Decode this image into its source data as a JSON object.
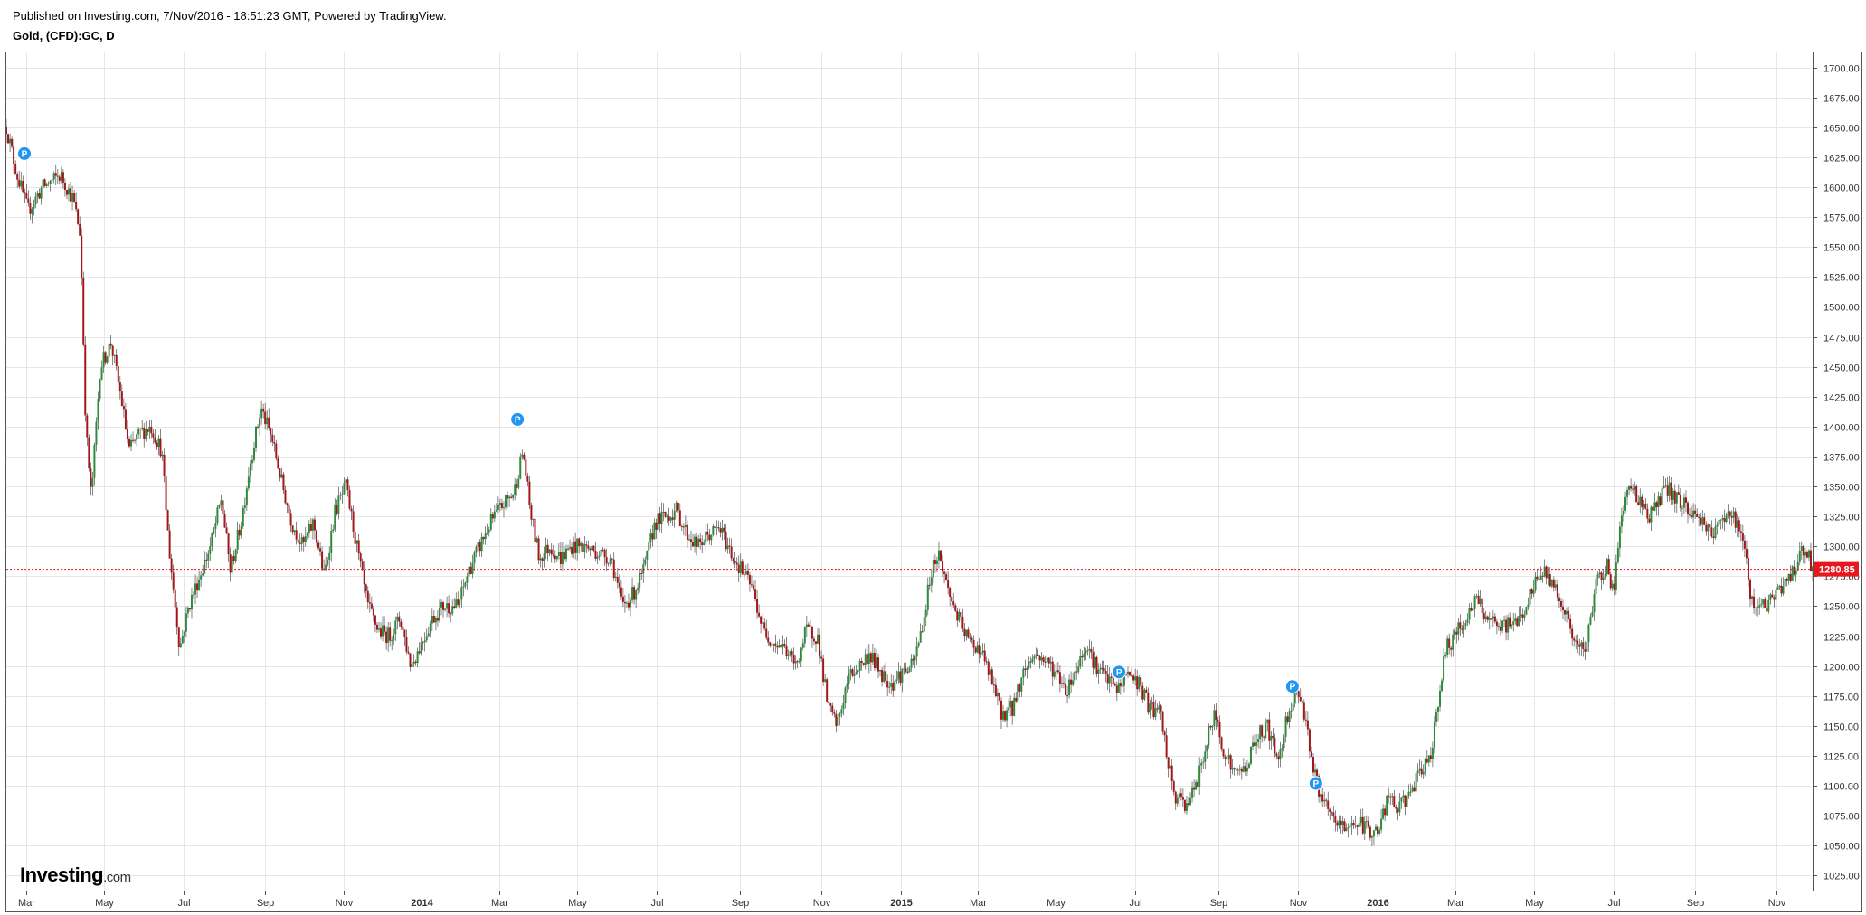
{
  "header": {
    "published": "Published on Investing.com, 7/Nov/2016 - 18:51:23 GMT, Powered by TradingView.",
    "symbol": "Gold, (CFD):GC, D"
  },
  "logo": {
    "brand": "Investing",
    "suffix": ".com"
  },
  "colors": {
    "up": "#2e8b3c",
    "down": "#a3171b",
    "wick": "#333333",
    "price_line": "#e8161d",
    "grid": "#e6e6e6"
  },
  "chart_data": {
    "type": "candlestick",
    "title": "Gold, (CFD):GC, D",
    "ylim": [
      1012.5,
      1712.5
    ],
    "yticks": [
      "1700.00",
      "1675.00",
      "1650.00",
      "1625.00",
      "1600.00",
      "1575.00",
      "1550.00",
      "1525.00",
      "1500.00",
      "1475.00",
      "1450.00",
      "1425.00",
      "1400.00",
      "1375.00",
      "1350.00",
      "1325.00",
      "1300.00",
      "1275.00",
      "1250.00",
      "1225.00",
      "1200.00",
      "1175.00",
      "1150.00",
      "1125.00",
      "1100.00",
      "1075.00",
      "1050.00",
      "1025.00"
    ],
    "xticks": [
      {
        "label": "Mar",
        "t": 0.011,
        "bold": false
      },
      {
        "label": "May",
        "t": 0.054,
        "bold": false
      },
      {
        "label": "Jul",
        "t": 0.098,
        "bold": false
      },
      {
        "label": "Sep",
        "t": 0.143,
        "bold": false
      },
      {
        "label": "Nov",
        "t": 0.187,
        "bold": false
      },
      {
        "label": "2014",
        "t": 0.23,
        "bold": true
      },
      {
        "label": "Mar",
        "t": 0.273,
        "bold": false
      },
      {
        "label": "May",
        "t": 0.316,
        "bold": false
      },
      {
        "label": "Jul",
        "t": 0.36,
        "bold": false
      },
      {
        "label": "Sep",
        "t": 0.406,
        "bold": false
      },
      {
        "label": "Nov",
        "t": 0.451,
        "bold": false
      },
      {
        "label": "2015",
        "t": 0.495,
        "bold": true
      },
      {
        "label": "Mar",
        "t": 0.538,
        "bold": false
      },
      {
        "label": "May",
        "t": 0.581,
        "bold": false
      },
      {
        "label": "Jul",
        "t": 0.625,
        "bold": false
      },
      {
        "label": "Sep",
        "t": 0.671,
        "bold": false
      },
      {
        "label": "Nov",
        "t": 0.715,
        "bold": false
      },
      {
        "label": "2016",
        "t": 0.759,
        "bold": true
      },
      {
        "label": "Mar",
        "t": 0.802,
        "bold": false
      },
      {
        "label": "May",
        "t": 0.846,
        "bold": false
      },
      {
        "label": "Jul",
        "t": 0.89,
        "bold": false
      },
      {
        "label": "Sep",
        "t": 0.935,
        "bold": false
      },
      {
        "label": "Nov",
        "t": 0.98,
        "bold": false
      }
    ],
    "current_price": 1280.85,
    "current_price_label": "1280.85",
    "trend": [
      [
        0.0,
        1650
      ],
      [
        0.006,
        1610
      ],
      [
        0.012,
        1580
      ],
      [
        0.02,
        1600
      ],
      [
        0.03,
        1610
      ],
      [
        0.037,
        1590
      ],
      [
        0.041,
        1560
      ],
      [
        0.044,
        1400
      ],
      [
        0.047,
        1340
      ],
      [
        0.052,
        1450
      ],
      [
        0.058,
        1470
      ],
      [
        0.064,
        1420
      ],
      [
        0.068,
        1380
      ],
      [
        0.074,
        1395
      ],
      [
        0.08,
        1400
      ],
      [
        0.086,
        1380
      ],
      [
        0.09,
        1300
      ],
      [
        0.096,
        1215
      ],
      [
        0.101,
        1250
      ],
      [
        0.107,
        1275
      ],
      [
        0.113,
        1300
      ],
      [
        0.119,
        1340
      ],
      [
        0.124,
        1280
      ],
      [
        0.13,
        1320
      ],
      [
        0.135,
        1370
      ],
      [
        0.141,
        1415
      ],
      [
        0.147,
        1390
      ],
      [
        0.153,
        1350
      ],
      [
        0.158,
        1320
      ],
      [
        0.164,
        1300
      ],
      [
        0.17,
        1320
      ],
      [
        0.176,
        1275
      ],
      [
        0.182,
        1330
      ],
      [
        0.188,
        1350
      ],
      [
        0.194,
        1300
      ],
      [
        0.2,
        1250
      ],
      [
        0.206,
        1230
      ],
      [
        0.212,
        1225
      ],
      [
        0.218,
        1240
      ],
      [
        0.224,
        1200
      ],
      [
        0.23,
        1220
      ],
      [
        0.236,
        1240
      ],
      [
        0.242,
        1250
      ],
      [
        0.25,
        1250
      ],
      [
        0.256,
        1280
      ],
      [
        0.262,
        1300
      ],
      [
        0.268,
        1320
      ],
      [
        0.275,
        1335
      ],
      [
        0.281,
        1345
      ],
      [
        0.286,
        1380
      ],
      [
        0.29,
        1330
      ],
      [
        0.295,
        1290
      ],
      [
        0.301,
        1300
      ],
      [
        0.307,
        1290
      ],
      [
        0.313,
        1300
      ],
      [
        0.32,
        1300
      ],
      [
        0.328,
        1295
      ],
      [
        0.335,
        1290
      ],
      [
        0.341,
        1250
      ],
      [
        0.347,
        1260
      ],
      [
        0.353,
        1280
      ],
      [
        0.359,
        1320
      ],
      [
        0.365,
        1325
      ],
      [
        0.371,
        1330
      ],
      [
        0.377,
        1310
      ],
      [
        0.383,
        1300
      ],
      [
        0.389,
        1310
      ],
      [
        0.395,
        1315
      ],
      [
        0.401,
        1295
      ],
      [
        0.407,
        1280
      ],
      [
        0.413,
        1265
      ],
      [
        0.419,
        1230
      ],
      [
        0.425,
        1220
      ],
      [
        0.431,
        1215
      ],
      [
        0.437,
        1200
      ],
      [
        0.443,
        1230
      ],
      [
        0.449,
        1225
      ],
      [
        0.455,
        1165
      ],
      [
        0.46,
        1150
      ],
      [
        0.466,
        1190
      ],
      [
        0.472,
        1200
      ],
      [
        0.478,
        1210
      ],
      [
        0.484,
        1195
      ],
      [
        0.49,
        1185
      ],
      [
        0.496,
        1195
      ],
      [
        0.502,
        1200
      ],
      [
        0.508,
        1240
      ],
      [
        0.512,
        1280
      ],
      [
        0.516,
        1295
      ],
      [
        0.522,
        1260
      ],
      [
        0.527,
        1240
      ],
      [
        0.533,
        1220
      ],
      [
        0.539,
        1215
      ],
      [
        0.545,
        1190
      ],
      [
        0.551,
        1160
      ],
      [
        0.557,
        1165
      ],
      [
        0.563,
        1195
      ],
      [
        0.569,
        1210
      ],
      [
        0.575,
        1205
      ],
      [
        0.581,
        1195
      ],
      [
        0.587,
        1180
      ],
      [
        0.593,
        1200
      ],
      [
        0.598,
        1220
      ],
      [
        0.603,
        1200
      ],
      [
        0.609,
        1190
      ],
      [
        0.615,
        1180
      ],
      [
        0.621,
        1195
      ],
      [
        0.627,
        1185
      ],
      [
        0.633,
        1165
      ],
      [
        0.639,
        1160
      ],
      [
        0.643,
        1120
      ],
      [
        0.647,
        1090
      ],
      [
        0.653,
        1085
      ],
      [
        0.659,
        1100
      ],
      [
        0.665,
        1140
      ],
      [
        0.669,
        1160
      ],
      [
        0.674,
        1130
      ],
      [
        0.68,
        1110
      ],
      [
        0.686,
        1115
      ],
      [
        0.692,
        1140
      ],
      [
        0.698,
        1150
      ],
      [
        0.704,
        1120
      ],
      [
        0.71,
        1165
      ],
      [
        0.716,
        1180
      ],
      [
        0.72,
        1150
      ],
      [
        0.724,
        1110
      ],
      [
        0.729,
        1085
      ],
      [
        0.735,
        1070
      ],
      [
        0.741,
        1065
      ],
      [
        0.747,
        1070
      ],
      [
        0.753,
        1065
      ],
      [
        0.759,
        1060
      ],
      [
        0.765,
        1090
      ],
      [
        0.771,
        1080
      ],
      [
        0.777,
        1095
      ],
      [
        0.783,
        1110
      ],
      [
        0.789,
        1130
      ],
      [
        0.793,
        1175
      ],
      [
        0.797,
        1215
      ],
      [
        0.802,
        1225
      ],
      [
        0.808,
        1240
      ],
      [
        0.814,
        1255
      ],
      [
        0.82,
        1240
      ],
      [
        0.826,
        1230
      ],
      [
        0.832,
        1235
      ],
      [
        0.838,
        1240
      ],
      [
        0.844,
        1260
      ],
      [
        0.85,
        1280
      ],
      [
        0.856,
        1270
      ],
      [
        0.862,
        1250
      ],
      [
        0.868,
        1220
      ],
      [
        0.874,
        1210
      ],
      [
        0.88,
        1270
      ],
      [
        0.886,
        1285
      ],
      [
        0.89,
        1260
      ],
      [
        0.894,
        1330
      ],
      [
        0.899,
        1350
      ],
      [
        0.904,
        1340
      ],
      [
        0.909,
        1325
      ],
      [
        0.914,
        1335
      ],
      [
        0.919,
        1350
      ],
      [
        0.924,
        1340
      ],
      [
        0.929,
        1335
      ],
      [
        0.935,
        1325
      ],
      [
        0.94,
        1320
      ],
      [
        0.946,
        1310
      ],
      [
        0.952,
        1330
      ],
      [
        0.958,
        1320
      ],
      [
        0.962,
        1300
      ],
      [
        0.966,
        1255
      ],
      [
        0.972,
        1250
      ],
      [
        0.978,
        1255
      ],
      [
        0.984,
        1270
      ],
      [
        0.99,
        1280
      ],
      [
        0.994,
        1300
      ],
      [
        0.998,
        1290
      ],
      [
        1.0,
        1281
      ]
    ],
    "markers": [
      {
        "t": 0.01,
        "price": 1628,
        "label": "P"
      },
      {
        "t": 0.283,
        "price": 1406,
        "label": "P"
      },
      {
        "t": 0.616,
        "price": 1195,
        "label": "P"
      },
      {
        "t": 0.712,
        "price": 1183,
        "label": "P"
      },
      {
        "t": 0.725,
        "price": 1102,
        "label": "P"
      }
    ]
  }
}
